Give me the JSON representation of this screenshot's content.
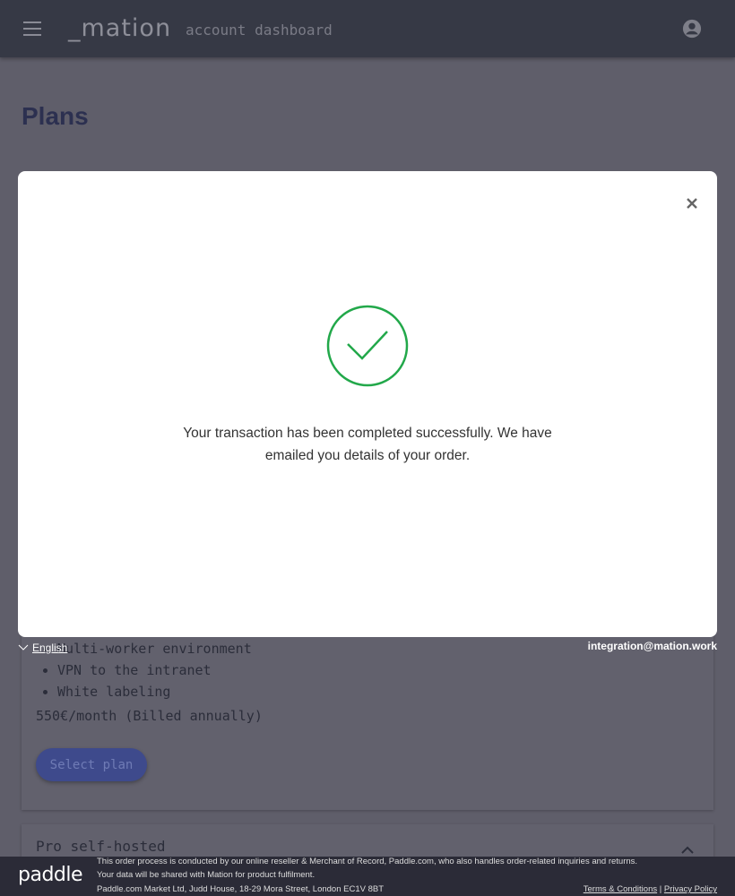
{
  "header": {
    "logo": "_mation",
    "subtitle": "account dashboard",
    "menu_icon": "menu-icon",
    "account_icon": "account-circle-icon"
  },
  "page": {
    "title": "Plans"
  },
  "plan_card": {
    "features": [
      "Multi-worker environment",
      "VPN to the intranet",
      "White labeling"
    ],
    "price": "550€/month (Billed annually)",
    "select_label": "Select plan"
  },
  "next_card": {
    "title": "Pro self-hosted"
  },
  "modal": {
    "message": "Your transaction has been completed successfully. We have emailed you details of your order.",
    "success_color": "#22a84a"
  },
  "checkout": {
    "language": "English",
    "email": "integration@mation.work"
  },
  "footer": {
    "logo": "paddle",
    "line1": "This order process is conducted by our online reseller & Merchant of Record, Paddle.com, who also handles order-related inquiries and returns.",
    "line2": "Your data will be shared with Mation for product fulfilment.",
    "line3": "Paddle.com Market Ltd, Judd House, 18-29 Mora Street, London EC1V 8BT",
    "terms": "Terms & Conditions",
    "separator": "|",
    "privacy": "Privacy Policy"
  }
}
